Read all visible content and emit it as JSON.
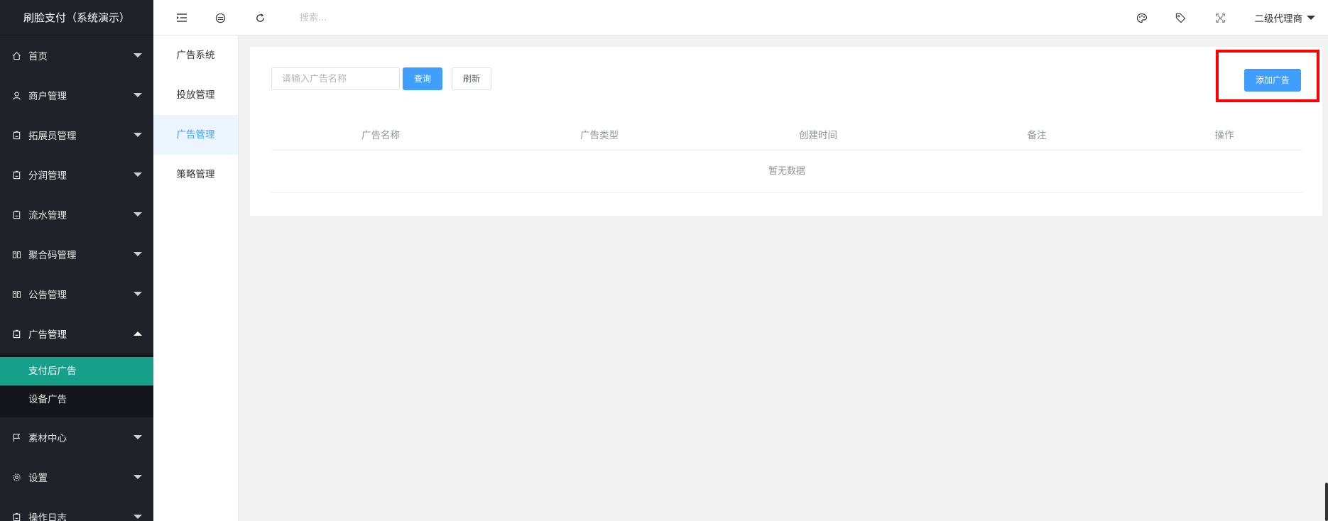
{
  "app": {
    "title": "刷脸支付（系统演示）"
  },
  "sidebar": {
    "items": [
      {
        "label": "首页",
        "icon": "home-icon"
      },
      {
        "label": "商户管理",
        "icon": "user-icon"
      },
      {
        "label": "拓展员管理",
        "icon": "clipboard-icon"
      },
      {
        "label": "分润管理",
        "icon": "clipboard-icon"
      },
      {
        "label": "流水管理",
        "icon": "clipboard-icon"
      },
      {
        "label": "聚合码管理",
        "icon": "read-icon"
      },
      {
        "label": "公告管理",
        "icon": "read-icon"
      },
      {
        "label": "广告管理",
        "icon": "clipboard-icon",
        "open": true
      }
    ],
    "open_submenu": [
      {
        "label": "支付后广告",
        "active": true
      },
      {
        "label": "设备广告",
        "active": false
      }
    ],
    "items_after": [
      {
        "label": "素材中心",
        "icon": "flag-icon"
      },
      {
        "label": "设置",
        "icon": "settings-icon"
      },
      {
        "label": "操作日志",
        "icon": "clipboard-icon"
      }
    ]
  },
  "header": {
    "search_placeholder": "搜索...",
    "user_label": "二级代理商"
  },
  "subnav": {
    "items": [
      {
        "label": "广告系统",
        "active": false
      },
      {
        "label": "投放管理",
        "active": false
      },
      {
        "label": "广告管理",
        "active": true
      },
      {
        "label": "策略管理",
        "active": false
      }
    ]
  },
  "toolbar": {
    "name_placeholder": "请输入广告名称",
    "query_label": "查询",
    "refresh_label": "刷新",
    "add_label": "添加广告"
  },
  "table": {
    "columns": [
      "广告名称",
      "广告类型",
      "创建时间",
      "备注",
      "操作"
    ],
    "empty_text": "暂无数据"
  },
  "colors": {
    "sidebar_bg": "#20222a",
    "active_green": "#16a08c",
    "primary_blue": "#409eff",
    "highlight_red": "#ff0000"
  }
}
